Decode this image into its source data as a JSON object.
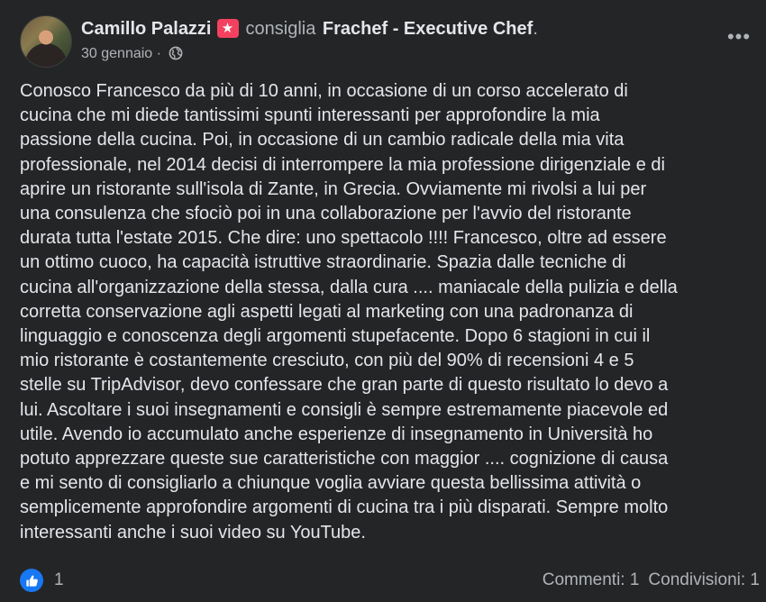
{
  "post": {
    "author": "Camillo Palazzi",
    "verb": "consiglia",
    "page": "Frachef - Executive Chef",
    "page_suffix": ".",
    "date": "30 gennaio",
    "separator": "·",
    "more_label": "•••",
    "badge_icon": "star-icon",
    "visibility_icon": "globe-icon",
    "text": "Conosco Francesco da più di 10 anni, in occasione di un corso accelerato di\ncucina che mi diede tantissimi spunti interessanti per approfondire la mia\npassione della cucina. Poi, in occasione di un cambio radicale della mia vita\nprofessionale, nel 2014 decisi di interrompere la mia professione dirigenziale e di\naprire un ristorante sull'isola di Zante, in Grecia. Ovviamente mi rivolsi a lui per\nuna consulenza che sfociò poi in una collaborazione per l'avvio del ristorante\ndurata tutta l'estate 2015. Che dire: uno spettacolo !!!! Francesco, oltre ad essere\nun ottimo cuoco, ha capacità istruttive straordinarie. Spazia dalle tecniche di\ncucina all'organizzazione della stessa, dalla cura .... maniacale della pulizia e della\ncorretta conservazione agli aspetti legati al marketing con una padronanza di\nlinguaggio e conoscenza degli argomenti stupefacente. Dopo 6 stagioni in cui il\nmio ristorante è costantemente cresciuto, con più del 90% di recensioni 4 e 5\nstelle su TripAdvisor, devo confessare che gran parte di questo risultato lo devo a\nlui. Ascoltare i suoi insegnamenti e consigli è sempre estremamente piacevole ed\nutile. Avendo io accumulato anche esperienze di insegnamento in Università ho\npotuto apprezzare queste sue caratteristiche con maggior .... cognizione di causa\ne mi sento di consigliarlo a chiunque voglia avviare questa bellissima attività o\nsemplicemente approfondire argomenti di cucina tra i più disparati. Sempre molto\ninteressanti anche i suoi video su YouTube."
  },
  "footer": {
    "like_icon": "thumbs-up-icon",
    "like_count": "1",
    "comments": "Commenti: 1",
    "shares": "Condivisioni: 1"
  },
  "colors": {
    "background": "#242526",
    "text_primary": "#e4e6eb",
    "text_secondary": "#b0b3b8",
    "like_blue": "#1877f2",
    "badge_pink": "#f3425f"
  }
}
